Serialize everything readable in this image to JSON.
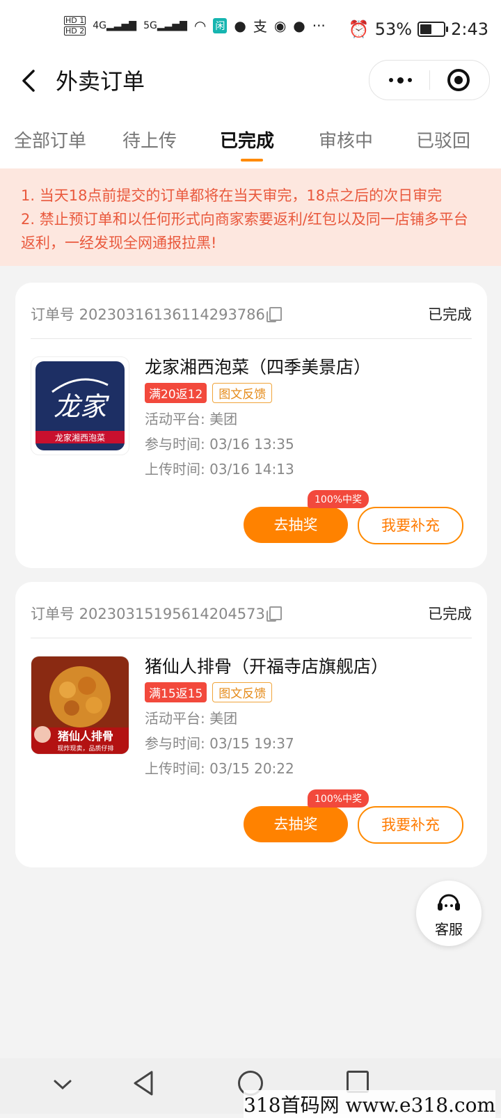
{
  "status_bar": {
    "network": "4G 5G",
    "battery": "53%",
    "battery_level": 0.53,
    "time": "2:43",
    "app_badge": "闲"
  },
  "header": {
    "title": "外卖订单"
  },
  "tabs": [
    {
      "label": "全部订单"
    },
    {
      "label": "待上传"
    },
    {
      "label": "已完成",
      "active": true
    },
    {
      "label": "审核中"
    },
    {
      "label": "已驳回"
    }
  ],
  "notice": {
    "line1": "1. 当天18点前提交的订单都将在当天审完，18点之后的次日审完",
    "line2": "2. 禁止预订单和以任何形式向商家索要返利/红包以及同一店铺多平台返利，一经发现全网通报拉黑!"
  },
  "orders": [
    {
      "order_no": "订单号 20230316136114293786",
      "status": "已完成",
      "shop": "龙家湘西泡菜（四季美景店）",
      "tag_rebate": "满20返12",
      "tag_type": "图文反馈",
      "platform": "活动平台:  美团",
      "join_time": "参与时间:  03/16 13:35",
      "upload_time": "上传时间:  03/16 14:13",
      "badge": "100%中奖",
      "draw_label": "去抽奖",
      "supplement_label": "我要补充",
      "thumb_text": "龙家",
      "thumb_sub": "龙家湘西泡菜"
    },
    {
      "order_no": "订单号 20230315195614204573",
      "status": "已完成",
      "shop": "猪仙人排骨（开福寺店旗舰店）",
      "tag_rebate": "满15返15",
      "tag_type": "图文反馈",
      "platform": "活动平台:  美团",
      "join_time": "参与时间:  03/15 19:37",
      "upload_time": "上传时间:  03/15 20:22",
      "badge": "100%中奖",
      "draw_label": "去抽奖",
      "supplement_label": "我要补充",
      "thumb_text": "猪仙人排骨",
      "thumb_sub": "现炸现卖，品质仔排"
    }
  ],
  "customer_service": {
    "label": "客服"
  },
  "watermark": "318首码网  www.e318.com",
  "colors": {
    "accent": "#ff8200",
    "notice_bg": "#fde7df",
    "notice_text": "#e9593d",
    "tag_red": "#f2493c"
  }
}
